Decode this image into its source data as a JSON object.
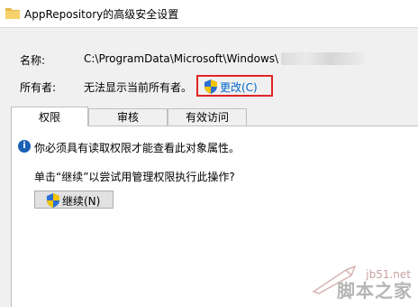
{
  "window": {
    "title": "AppRepository的高级安全设置"
  },
  "fields": {
    "name_label": "名称:",
    "name_value": "C:\\ProgramData\\Microsoft\\Windows\\",
    "owner_label": "所有者:",
    "owner_value": "无法显示当前所有者。",
    "change_link": "更改(C)"
  },
  "tabs": [
    {
      "label": "权限",
      "active": true
    },
    {
      "label": "审核",
      "active": false
    },
    {
      "label": "有效访问",
      "active": false
    }
  ],
  "panel": {
    "info_text": "你必须具有读取权限才能查看此对象属性。",
    "inherit_prompt": "单击“继续”以尝试用管理权限执行此操作?",
    "continue_button": "继续(N)"
  },
  "watermark": {
    "site": "jb51.net",
    "brand": "脚本之家"
  },
  "colors": {
    "highlight_border": "#e02424",
    "link": "#0066cc",
    "info_icon": "#1a5fb4"
  },
  "icons": {
    "title": "folder-icon",
    "change": "uac-shield-icon",
    "info": "info-icon",
    "continue": "uac-shield-icon"
  }
}
